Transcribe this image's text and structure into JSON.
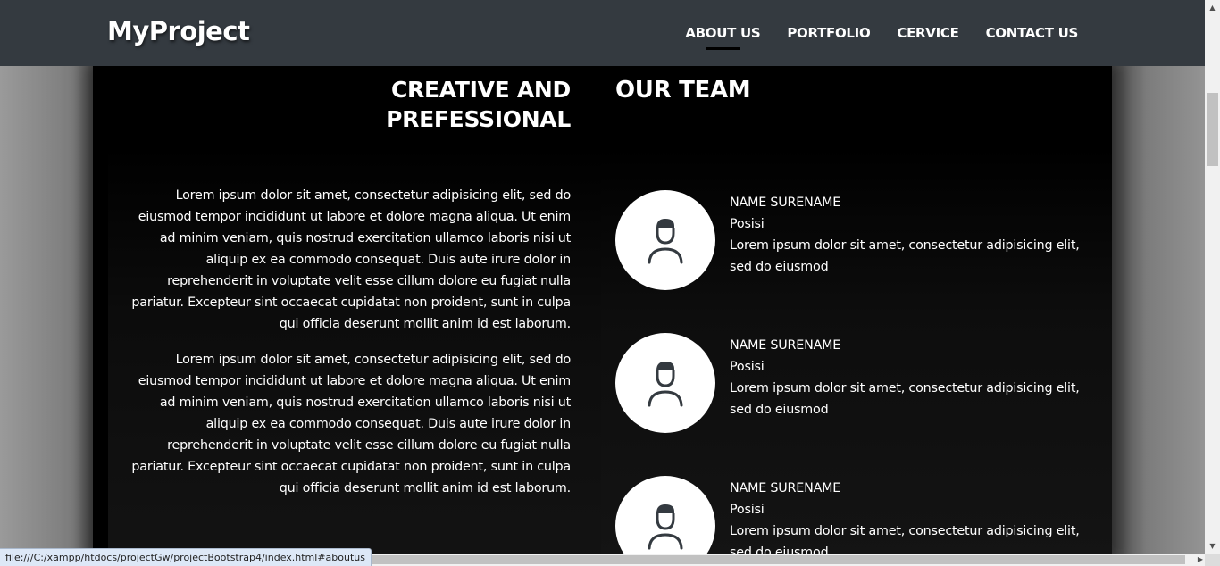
{
  "header": {
    "brand": "MyProject",
    "nav": [
      {
        "label": "ABOUT US",
        "active": true
      },
      {
        "label": "PORTFOLIO",
        "active": false
      },
      {
        "label": "CERVICE",
        "active": false
      },
      {
        "label": "CONTACT US",
        "active": false
      }
    ]
  },
  "about": {
    "heading_line1": "CREATIVE AND",
    "heading_line2": "PREFESSIONAL",
    "paragraphs": [
      "Lorem ipsum dolor sit amet, consectetur adipisicing elit, sed do eiusmod tempor incididunt ut labore et dolore magna aliqua. Ut enim ad minim veniam, quis nostrud exercitation ullamco laboris nisi ut aliquip ex ea commodo consequat. Duis aute irure dolor in reprehenderit in voluptate velit esse cillum dolore eu fugiat nulla pariatur. Excepteur sint occaecat cupidatat non proident, sunt in culpa qui officia deserunt mollit anim id est laborum.",
      "Lorem ipsum dolor sit amet, consectetur adipisicing elit, sed do eiusmod tempor incididunt ut labore et dolore magna aliqua. Ut enim ad minim veniam, quis nostrud exercitation ullamco laboris nisi ut aliquip ex ea commodo consequat. Duis aute irure dolor in reprehenderit in voluptate velit esse cillum dolore eu fugiat nulla pariatur. Excepteur sint occaecat cupidatat non proident, sunt in culpa qui officia deserunt mollit anim id est laborum."
    ]
  },
  "team": {
    "heading": "OUR TEAM",
    "members": [
      {
        "name": "NAME SURENAME",
        "position": "Posisi",
        "bio": "Lorem ipsum dolor sit amet, consectetur adipisicing elit, sed do eiusmod",
        "avatar_icon": "user-icon"
      },
      {
        "name": "NAME SURENAME",
        "position": "Posisi",
        "bio": "Lorem ipsum dolor sit amet, consectetur adipisicing elit, sed do eiusmod",
        "avatar_icon": "user-icon"
      },
      {
        "name": "NAME SURENAME",
        "position": "Posisi",
        "bio": "Lorem ipsum dolor sit amet, consectetur adipisicing elit, sed do eiusmod",
        "avatar_icon": "user-icon"
      }
    ]
  },
  "status_bar": {
    "url": "file:///C:/xampp/htdocs/projectGw/projectBootstrap4/index.html#aboutus"
  },
  "colors": {
    "navbar": "#343a40",
    "panel": "#000000",
    "avatar_bg": "#ffffff",
    "icon": "#343a40"
  }
}
